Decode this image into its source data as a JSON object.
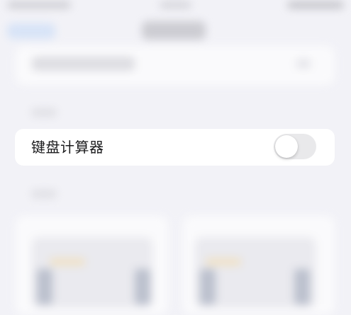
{
  "settings_row": {
    "label": "键盘计算器",
    "toggle_on": false
  },
  "colors": {
    "background": "#f2f2f7",
    "row_background": "#ffffff",
    "toggle_off": "#e9e9eb",
    "label_text": "#1c1c1e"
  },
  "icons": {
    "toggle": "switch-off"
  }
}
